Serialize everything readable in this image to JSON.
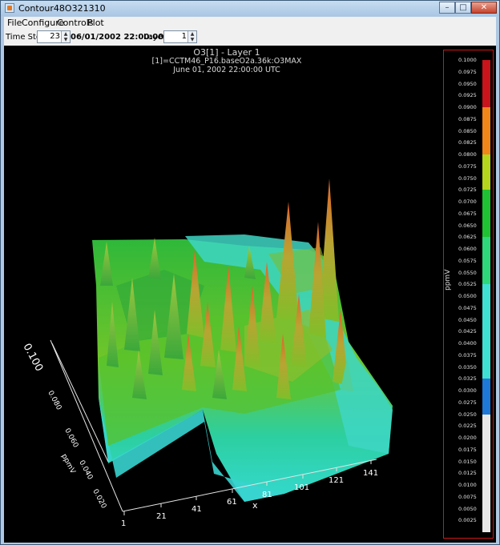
{
  "window": {
    "title": "Contour48O321310"
  },
  "menu": [
    "File",
    "Configure",
    "Controls",
    "Plot"
  ],
  "toolbar": {
    "time_step_label": "Time Step:",
    "time_step_value": "23",
    "date": "06/01/2002 22:00:00",
    "layer_label": "Layer:",
    "layer_value": "1"
  },
  "plot": {
    "title": "O3[1] - Layer 1",
    "subtitle": "[1]=CCTM46_P16.baseO2a.36k:O3MAX",
    "time": "June 01, 2002 22:00:00 UTC",
    "x_label": "x",
    "x_ticks": [
      "1",
      "21",
      "41",
      "61",
      "81",
      "101",
      "121",
      "141"
    ],
    "y_label": "ppmV",
    "z_ticks": [
      "0.100",
      "0.080",
      "0.060",
      "0.040",
      "0.020"
    ]
  },
  "legend": {
    "units": "ppmV",
    "labels": [
      "0.1000",
      "0.0975",
      "0.0950",
      "0.0925",
      "0.0900",
      "0.0875",
      "0.0850",
      "0.0825",
      "0.0800",
      "0.0775",
      "0.0750",
      "0.0725",
      "0.0700",
      "0.0675",
      "0.0650",
      "0.0625",
      "0.0600",
      "0.0575",
      "0.0550",
      "0.0525",
      "0.0500",
      "0.0475",
      "0.0450",
      "0.0425",
      "0.0400",
      "0.0375",
      "0.0350",
      "0.0325",
      "0.0300",
      "0.0275",
      "0.0250",
      "0.0225",
      "0.0200",
      "0.0175",
      "0.0150",
      "0.0125",
      "0.0100",
      "0.0075",
      "0.0050",
      "0.0025"
    ],
    "bands": [
      {
        "color": "#c8141a",
        "count": 4
      },
      {
        "color": "#f08519",
        "count": 4
      },
      {
        "color": "#b5d41c",
        "count": 3
      },
      {
        "color": "#1fc232",
        "count": 4
      },
      {
        "color": "#2dd77a",
        "count": 4
      },
      {
        "color": "#3fe0d1",
        "count": 8
      },
      {
        "color": "#1e78d8",
        "count": 3
      },
      {
        "color": "#e8e8e8",
        "count": 10
      }
    ]
  }
}
